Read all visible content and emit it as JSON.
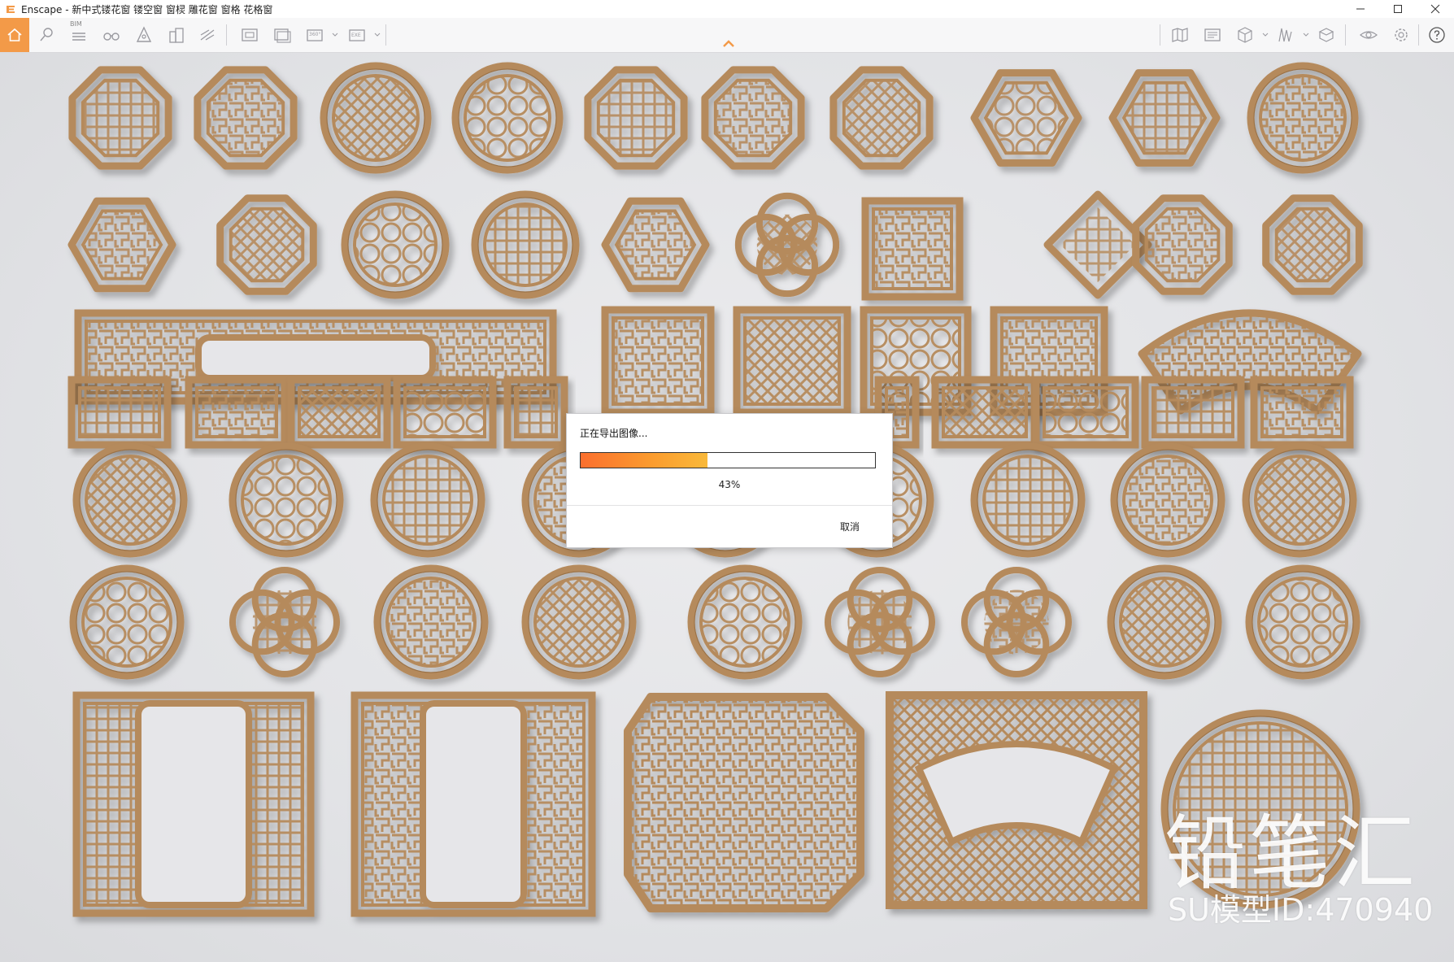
{
  "window": {
    "app_name": "Enscape",
    "title": "Enscape - 新中式镂花窗 镂空窗 窗棂 雕花窗 窗格 花格窗",
    "controls": [
      "minimize-icon",
      "maximize-icon",
      "close-icon"
    ]
  },
  "toolbar": {
    "bim_label": "BIM",
    "icons": [
      "home-icon",
      "pin-icon",
      "bim-list-icon",
      "binoculars-icon",
      "navigation-icon",
      "buildings-icon",
      "views-icon",
      "screenshot-icon",
      "batch-render-icon",
      "panorama-360-icon",
      "exe-export-icon",
      "map-icon",
      "upload-icon",
      "cube-icon",
      "asset-library-icon",
      "materials-icon",
      "visual-settings-icon",
      "settings-icon",
      "help-icon"
    ],
    "panorama_label": "360°",
    "exe_label": "EXE"
  },
  "colors": {
    "accent": "#f39a48",
    "wood": "#b58a5c",
    "wood_dark": "#8a6239",
    "progress_start": "#fb6f2e",
    "progress_end": "#f9b93a"
  },
  "dialog": {
    "title": "正在导出图像...",
    "progress": 0.43,
    "percent_label": "43%",
    "cancel_label": "取消"
  },
  "watermark": {
    "brand": "铅笔汇",
    "model_id": "SU模型ID:470940"
  }
}
